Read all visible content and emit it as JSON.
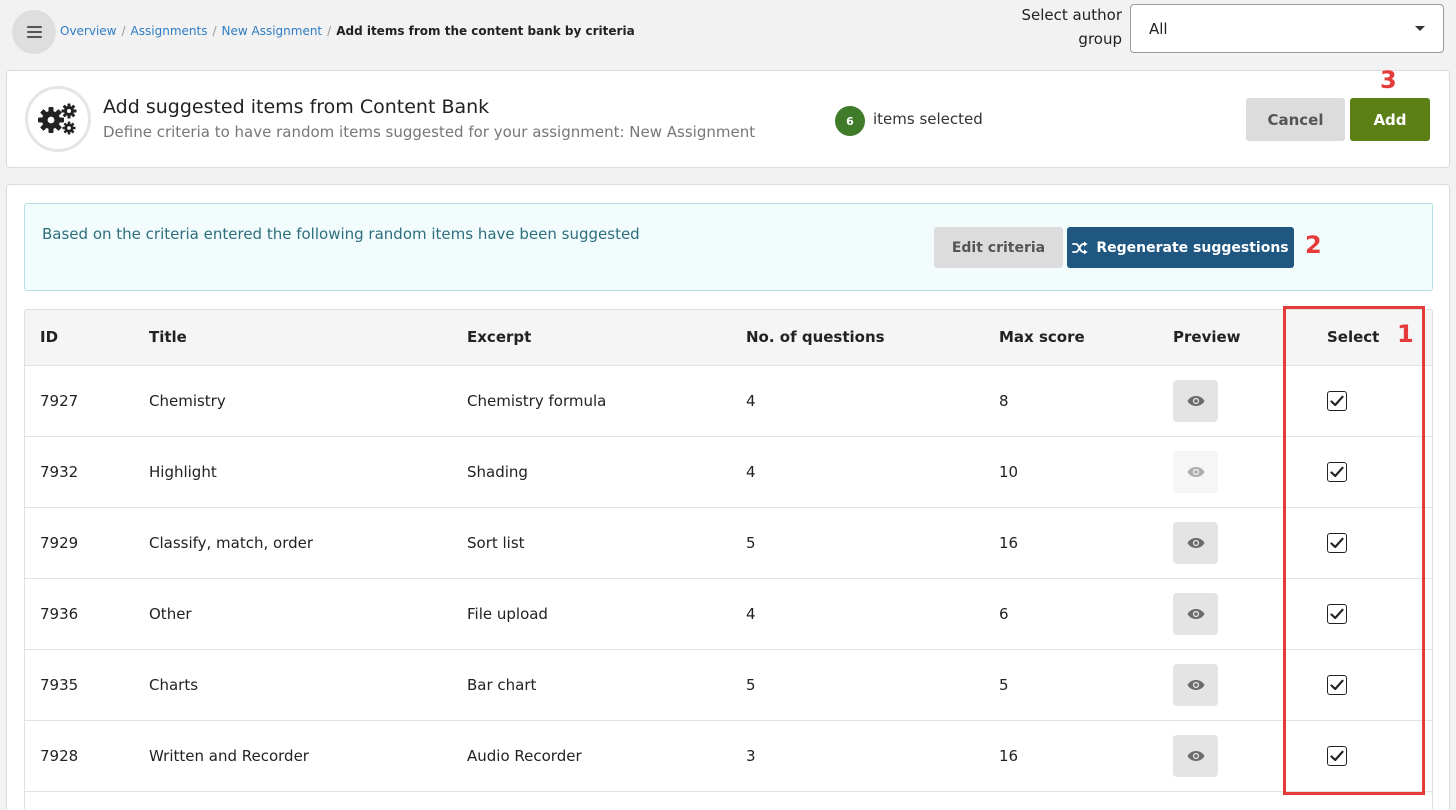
{
  "breadcrumb": {
    "items": [
      "Overview",
      "Assignments",
      "New Assignment"
    ],
    "separator": "/",
    "current": "Add items from the content bank by criteria"
  },
  "author_group": {
    "label": "Select author group",
    "selected": "All"
  },
  "header": {
    "icon": "gears-icon",
    "title": "Add suggested items from Content Bank",
    "subtitle": "Define criteria to have random items suggested for your assignment: New Assignment",
    "selected_count": "6",
    "selected_text": "items selected",
    "cancel_label": "Cancel",
    "add_label": "Add"
  },
  "suggestions": {
    "info_text": "Based on the criteria entered the following random items have been suggested",
    "edit_label": "Edit criteria",
    "regenerate_label": "Regenerate suggestions"
  },
  "annotations": {
    "one": "1",
    "two": "2",
    "three": "3"
  },
  "table": {
    "headers": {
      "id": "ID",
      "title": "Title",
      "excerpt": "Excerpt",
      "questions": "No. of questions",
      "max_score": "Max score",
      "preview": "Preview",
      "select": "Select"
    },
    "rows": [
      {
        "id": "7927",
        "title": "Chemistry",
        "excerpt": "Chemistry formula",
        "questions": "4",
        "max_score": "8",
        "preview_enabled": true,
        "selected": true
      },
      {
        "id": "7932",
        "title": "Highlight",
        "excerpt": "Shading",
        "questions": "4",
        "max_score": "10",
        "preview_enabled": false,
        "selected": true
      },
      {
        "id": "7929",
        "title": "Classify, match, order",
        "excerpt": "Sort list",
        "questions": "5",
        "max_score": "16",
        "preview_enabled": true,
        "selected": true
      },
      {
        "id": "7936",
        "title": "Other",
        "excerpt": "File upload",
        "questions": "4",
        "max_score": "6",
        "preview_enabled": true,
        "selected": true
      },
      {
        "id": "7935",
        "title": "Charts",
        "excerpt": "Bar chart",
        "questions": "5",
        "max_score": "5",
        "preview_enabled": true,
        "selected": true
      },
      {
        "id": "7928",
        "title": "Written and Recorder",
        "excerpt": "Audio Recorder",
        "questions": "3",
        "max_score": "16",
        "preview_enabled": true,
        "selected": true
      }
    ]
  },
  "colors": {
    "link": "#2f7bc4",
    "add_button": "#5c7f16",
    "regenerate_button": "#1f5781",
    "badge": "#3f7b28",
    "annotation": "#e53b3b",
    "info_text": "#2d6e7c"
  }
}
